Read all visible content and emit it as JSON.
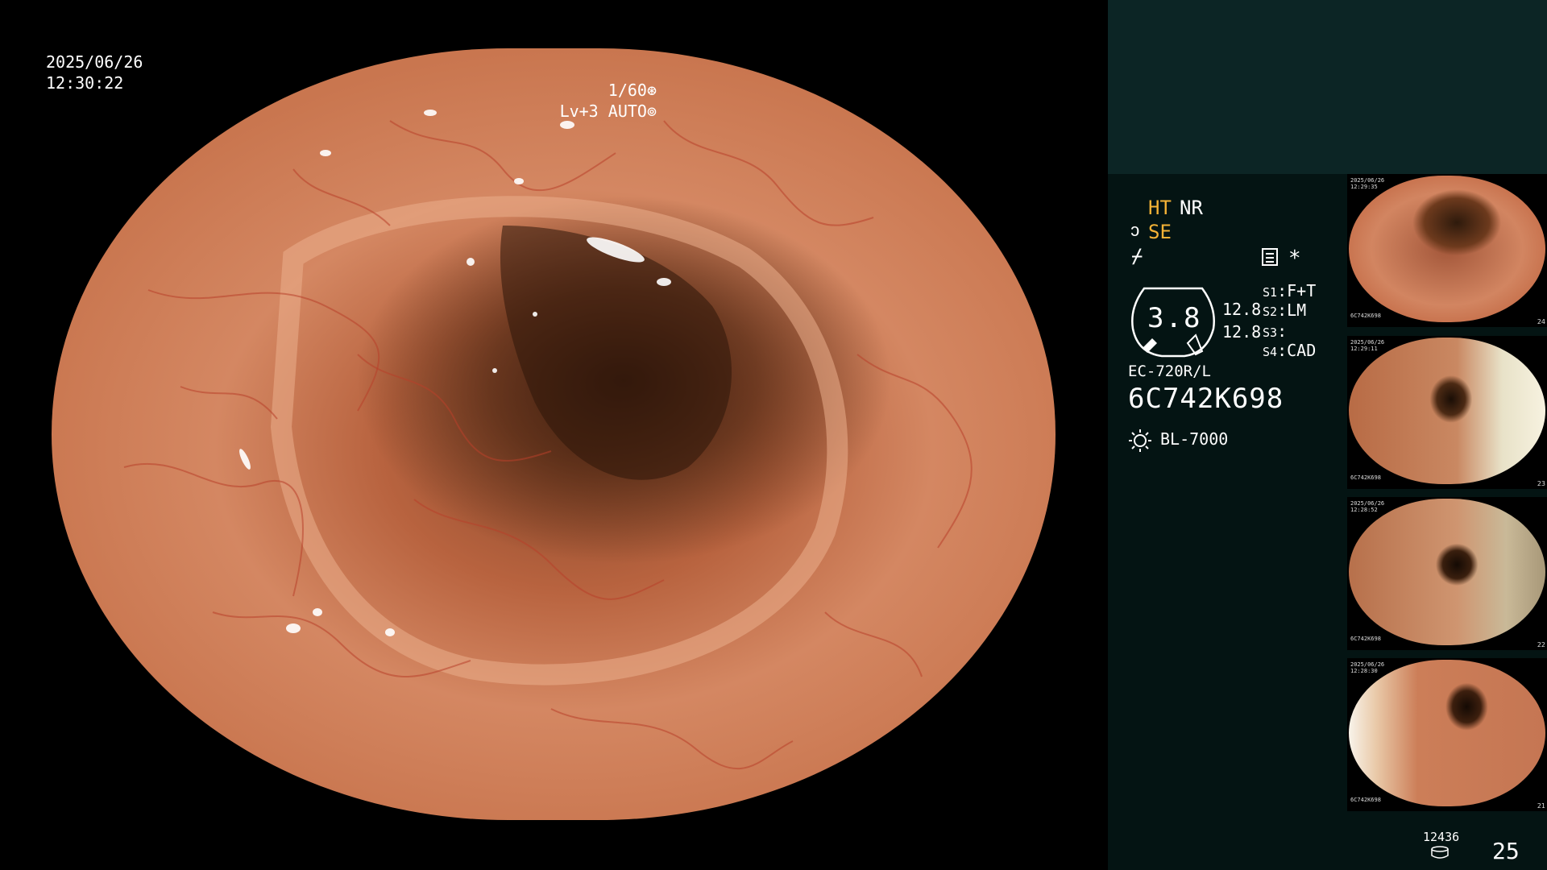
{
  "overlay": {
    "date": "2025/06/26",
    "time": "12:30:22",
    "shutter": "1/60",
    "level": "Lv+3",
    "mode": "AUTO"
  },
  "panel": {
    "ht": "HT",
    "nr": "NR",
    "se": "SE",
    "gauge_value": "3.8",
    "gain_top": "12.8",
    "gain_bottom": "12.8",
    "switches": [
      {
        "key": "S1",
        "value": "F+T"
      },
      {
        "key": "S2",
        "value": "LM"
      },
      {
        "key": "S3",
        "value": ""
      },
      {
        "key": "S4",
        "value": "CAD"
      }
    ],
    "scope_model": "EC-720R/L",
    "scope_serial": "6C742K698",
    "light_source": "BL-7000",
    "record_count": "12436",
    "frame_count": "25",
    "accent_color": "#f5b236"
  },
  "icons": {
    "shutter": "aperture-icon",
    "mode": "auto-dial-icon",
    "se": "structure-enhance-icon",
    "irregular": "irregular-icon",
    "memory": "memory-card-icon",
    "asterisk": "asterisk-icon",
    "light": "light-source-icon",
    "record": "record-stack-icon"
  },
  "thumbnails": [
    {
      "date": "2025/06/26",
      "time": "12:29:35",
      "serial": "6C742K698",
      "index": "24"
    },
    {
      "date": "2025/06/26",
      "time": "12:29:11",
      "serial": "6C742K698",
      "index": "23"
    },
    {
      "date": "2025/06/26",
      "time": "12:28:52",
      "serial": "6C742K698",
      "index": "22"
    },
    {
      "date": "2025/06/26",
      "time": "12:28:30",
      "serial": "6C742K698",
      "index": "21"
    }
  ]
}
